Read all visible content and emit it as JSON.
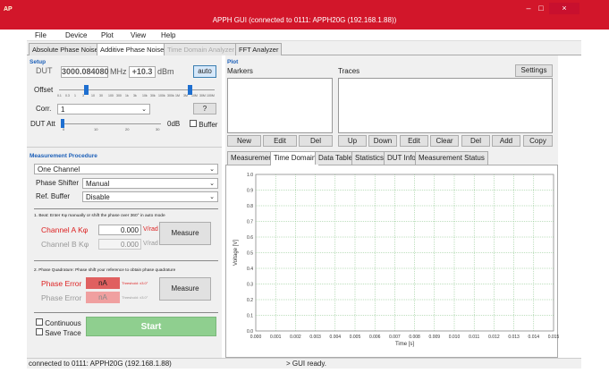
{
  "titlebar": {
    "logo": "AP",
    "title": "APPH GUI (connected to 0111: APPH20G (192.168.1.88))",
    "min": "–",
    "max": "□",
    "close": "×"
  },
  "menu": [
    "File",
    "Device",
    "Plot",
    "View",
    "Help"
  ],
  "tabs": [
    {
      "label": "Absolute Phase Noise",
      "state": "normal"
    },
    {
      "label": "Additive Phase Noise",
      "state": "active"
    },
    {
      "label": "Time Domain Analyzer",
      "state": "disabled"
    },
    {
      "label": "FFT Analyzer",
      "state": "normal"
    }
  ],
  "setup": {
    "heading": "Setup",
    "dut_label": "DUT",
    "dut_freq": "3000.084080",
    "freq_unit": "MHz",
    "power": "+10.3",
    "power_unit": "dBm",
    "auto_label": "auto",
    "offset_label": "Offset",
    "offset_ticks": [
      "0.1",
      "0.3",
      "1",
      "3",
      "10",
      "30",
      "100",
      "300",
      "1k",
      "3k",
      "10k",
      "30k",
      "100k",
      "300k",
      "1M",
      "3M",
      "10M",
      "30M",
      "100M"
    ],
    "corr_label": "Corr.",
    "corr_value": "1",
    "help_label": "?",
    "att_label": "DUT Att",
    "att_ticks": [
      "0",
      "10",
      "20",
      "30"
    ],
    "att_value": "0dB",
    "buffer_label": "Buffer"
  },
  "procedure": {
    "heading": "Measurement Procedure",
    "mode": "One Channel",
    "shifter_label": "Phase Shifter",
    "shifter_value": "Manual",
    "refbuf_label": "Ref. Buffer",
    "refbuf_value": "Disable",
    "beat_title": "1. Beat: Enter Kφ manually or shift the phase over 360° in auto mode",
    "chA_label": "Channel A Kφ",
    "chA_value": "0.000",
    "chA_unit": "V/rad",
    "chB_label": "Channel B Kφ",
    "chB_value": "0.000",
    "chB_unit": "V/rad",
    "measure1": "Measure",
    "quad_title": "2. Phase Quadrature: Phase shift your reference to obtain phase quadrature",
    "perr_label": "Phase Error",
    "perr_value": "nA",
    "perr_thr": "Threshold: ±3.0°",
    "perr2_label": "Phase Error",
    "perr2_value": "nA",
    "perr2_thr": "Threshold: ±3.0°",
    "measure2": "Measure",
    "continuous_label": "Continuous",
    "savetrace_label": "Save Trace",
    "start_label": "Start"
  },
  "plot": {
    "heading": "Plot",
    "markers_label": "Markers",
    "traces_label": "Traces",
    "settings_label": "Settings",
    "marker_btns": [
      "New",
      "Edit",
      "Del"
    ],
    "trace_btns": [
      "Up",
      "Down",
      "Edit",
      "Clear",
      "Del",
      "Add",
      "Copy"
    ],
    "subtabs": [
      "Measurement",
      "Time Domain",
      "Data Table",
      "Statistics",
      "DUT Info",
      "Measurement Status"
    ],
    "active_subtab": 1
  },
  "chart_data": {
    "type": "line",
    "series": [],
    "xlabel": "Time [s]",
    "ylabel": "Voltage [V]",
    "xlim": [
      0,
      0.015
    ],
    "ylim": [
      0,
      1.0
    ],
    "xticks": [
      "0.000",
      "0.001",
      "0.002",
      "0.003",
      "0.004",
      "0.005",
      "0.006",
      "0.007",
      "0.008",
      "0.009",
      "0.010",
      "0.011",
      "0.012",
      "0.013",
      "0.014",
      "0.015"
    ],
    "yticks": [
      "0.0",
      "0.1",
      "0.2",
      "0.3",
      "0.4",
      "0.5",
      "0.6",
      "0.7",
      "0.8",
      "0.9",
      "1.0"
    ],
    "grid": true,
    "grid_color": "#7fbf7f"
  },
  "status": {
    "left": "connected to 0111: APPH20G (192.168.1.88)",
    "right": "> GUI ready."
  },
  "colors": {
    "accent": "#d2162a",
    "start_button": "#8fcf8f",
    "error_field": "#e06060",
    "label_red": "#d22"
  }
}
